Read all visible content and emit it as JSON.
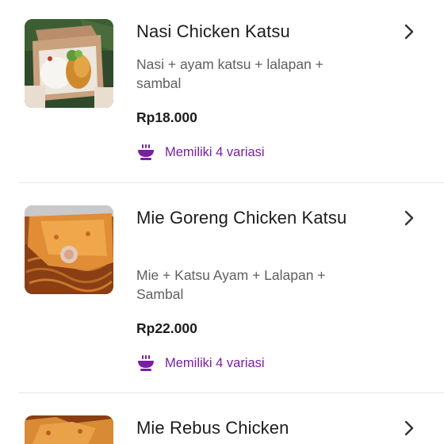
{
  "menu_items": [
    {
      "name": "Nasi Chicken Katsu",
      "description": "Nasi + ayam katsu + lalapan + sambal",
      "price": "Rp18.000",
      "variants": "Memiliki 4 variasi"
    },
    {
      "name": "Mie Goreng Chicken Katsu",
      "description": "Mie + Katsu Ayam + Lalapan + Sambal",
      "price": "Rp22.000",
      "variants": "Memiliki 4 variasi"
    },
    {
      "name": "Mie Rebus Chicken"
    }
  ],
  "colors": {
    "accent": "#7a1fa2",
    "title": "#1c1c1c",
    "description": "#5f5f5f",
    "chevron": "#333333",
    "divider": "#e6e6e6"
  },
  "icons": {
    "variant": "bowl-icon",
    "open": "chevron-right-icon"
  }
}
